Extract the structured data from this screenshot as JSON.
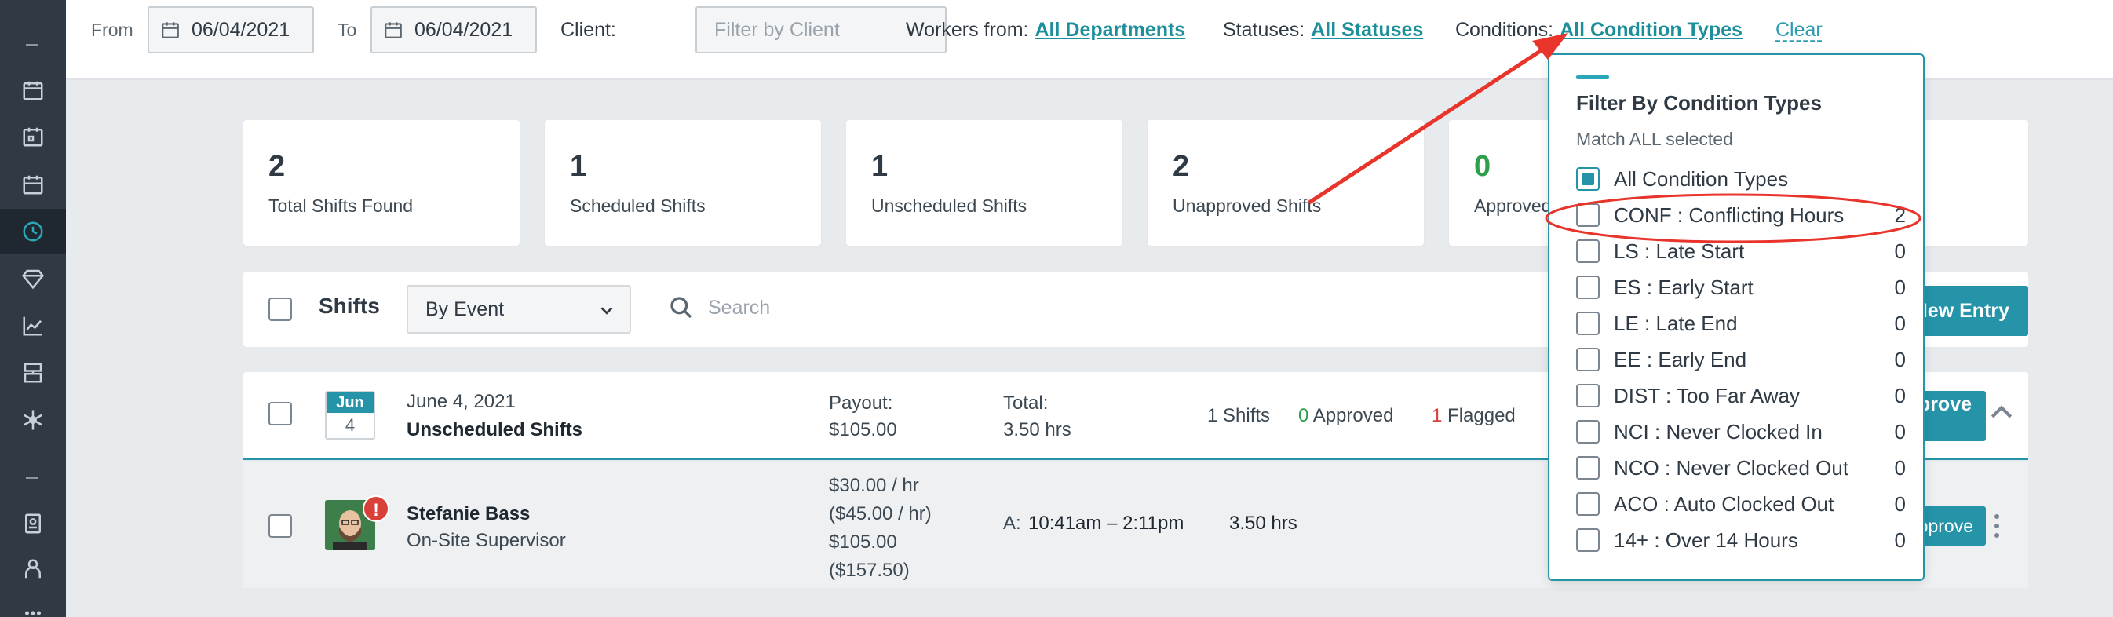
{
  "filters": {
    "from_label": "From",
    "from_value": "06/04/2021",
    "to_label": "To",
    "to_value": "06/04/2021",
    "client_label": "Client:",
    "client_placeholder": "Filter by Client",
    "workers_label": "Workers from:",
    "workers_value": "All Departments",
    "statuses_label": "Statuses:",
    "statuses_value": "All Statuses",
    "conditions_label": "Conditions:",
    "conditions_value": "All Condition Types",
    "clear_label": "Clear"
  },
  "stats": [
    {
      "value": "2",
      "label": "Total Shifts Found"
    },
    {
      "value": "1",
      "label": "Scheduled Shifts"
    },
    {
      "value": "1",
      "label": "Unscheduled Shifts"
    },
    {
      "value": "2",
      "label": "Unapproved Shifts"
    },
    {
      "value": "0",
      "label": "Approved Shifts"
    }
  ],
  "toolbar": {
    "title": "Shifts",
    "group_by": "By Event",
    "search_placeholder": "Search",
    "new_entry_label": "New Entry"
  },
  "group": {
    "month": "Jun",
    "day": "4",
    "date": "June 4, 2021",
    "title": "Unscheduled Shifts",
    "payout_label": "Payout:",
    "payout_value": "$105.00",
    "total_label": "Total:",
    "total_value": "3.50 hrs",
    "shifts_count": "1 Shifts",
    "approved_num": "0",
    "approved_word": "Approved",
    "flagged_num": "1",
    "flagged_word": "Flagged",
    "approve_all_label": "Approve All"
  },
  "shift": {
    "name": "Stefanie Bass",
    "role": "On-Site Supervisor",
    "rate": "$30.00 / hr",
    "rate_alt": "($45.00 / hr)",
    "pay": "$105.00",
    "pay_alt": "($157.50)",
    "time_prefix": "A:",
    "time_range": "10:41am – 2:11pm",
    "hours": "3.50 hrs",
    "alert": "!",
    "approve_label": "Approve"
  },
  "conditions_panel": {
    "title": "Filter By Condition Types",
    "subtitle": "Match ALL selected",
    "options": [
      {
        "label": "All Condition Types",
        "count": "",
        "checked": true
      },
      {
        "label": "CONF : Conflicting Hours",
        "count": "2",
        "checked": false
      },
      {
        "label": "LS : Late Start",
        "count": "0",
        "checked": false
      },
      {
        "label": "ES : Early Start",
        "count": "0",
        "checked": false
      },
      {
        "label": "LE : Late End",
        "count": "0",
        "checked": false
      },
      {
        "label": "EE : Early End",
        "count": "0",
        "checked": false
      },
      {
        "label": "DIST : Too Far Away",
        "count": "0",
        "checked": false
      },
      {
        "label": "NCI : Never Clocked In",
        "count": "0",
        "checked": false
      },
      {
        "label": "NCO : Never Clocked Out",
        "count": "0",
        "checked": false
      },
      {
        "label": "ACO : Auto Clocked Out",
        "count": "0",
        "checked": false
      },
      {
        "label": "14+ : Over 14 Hours",
        "count": "0",
        "checked": false
      }
    ]
  },
  "colors": {
    "sidebar": "#2f3a44",
    "accent": "#2594a9",
    "approved": "#2e9f4a",
    "flagged": "#d9403a",
    "annotation": "#e8342a"
  },
  "icons": [
    "calendar-icon",
    "clock-icon",
    "diamond-icon",
    "chart-icon",
    "snowflake-icon",
    "search-icon",
    "chevron-down-icon",
    "chevron-up-icon"
  ]
}
